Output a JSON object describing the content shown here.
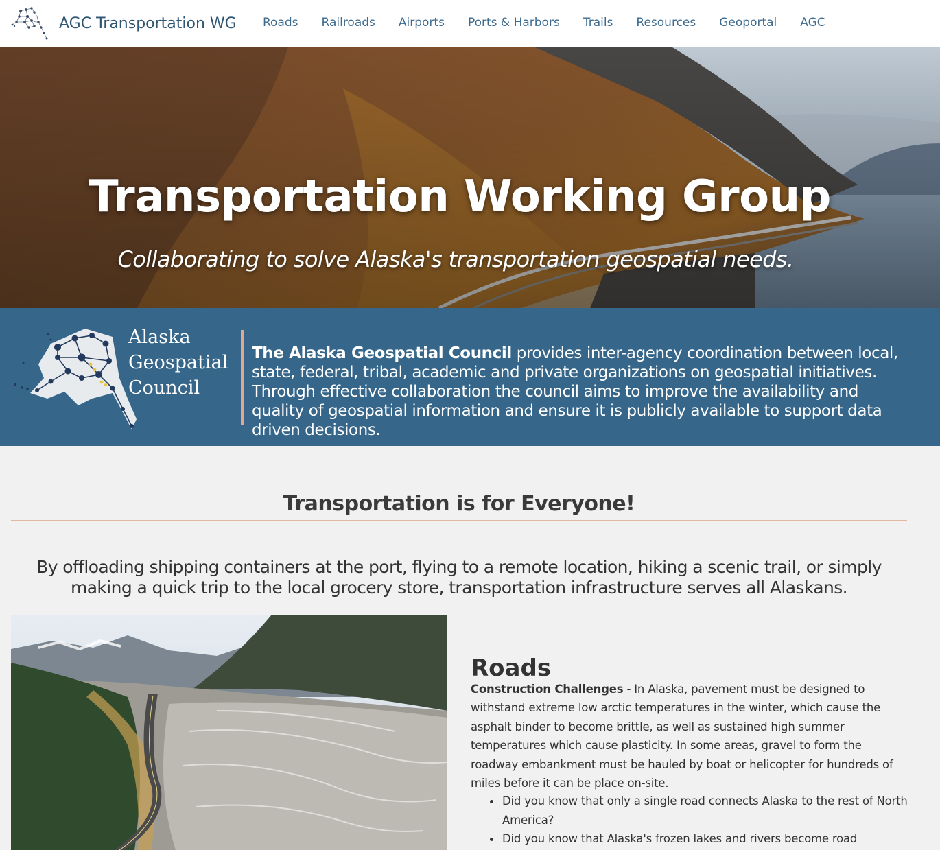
{
  "header": {
    "site_title": "AGC Transportation WG",
    "logo_icon": "alaska-network-logo-icon",
    "nav": [
      {
        "label": "Roads"
      },
      {
        "label": "Railroads"
      },
      {
        "label": "Airports"
      },
      {
        "label": "Ports & Harbors"
      },
      {
        "label": "Trails"
      },
      {
        "label": "Resources"
      },
      {
        "label": "Geoportal"
      },
      {
        "label": "AGC"
      }
    ]
  },
  "hero": {
    "title": "Transportation Working Group",
    "subtitle": "Collaborating to solve Alaska's transportation geospatial needs."
  },
  "council": {
    "logo_lines": [
      "Alaska",
      "Geospatial",
      "Council"
    ],
    "name": "The Alaska Geospatial Council",
    "description": " provides inter-agency coordination between local, state, federal, tribal, academic and private organizations on geospatial initiatives. Through effective collaboration the council aims to improve the availability and quality of geospatial information and ensure it is publicly available to support data driven decisions."
  },
  "everyone": {
    "title": "Transportation is for Everyone!",
    "body": "By offloading shipping containers at the port, flying to a remote location, hiking a scenic trail, or simply making a quick trip to the local grocery store, transportation infrastructure serves all Alaskans."
  },
  "roads": {
    "heading": "Roads",
    "lead": "Construction Challenges",
    "text": "  - In Alaska, pavement must be designed to withstand extreme low arctic temperatures in the winter, which cause the asphalt binder to become brittle, as well as sustained high summer temperatures which cause plasticity. In some areas, gravel to form the roadway embankment must be hauled by boat or helicopter for hundreds of miles before it can be place on-site.",
    "bullets": [
      "Did you know that only a single road connects Alaska to the rest of North America?",
      "Did you know that Alaska's frozen lakes and rivers become road"
    ]
  },
  "colors": {
    "brand_blue": "#36668a",
    "nav_text": "#3d6b8f",
    "accent_rule": "#e3b79f"
  }
}
